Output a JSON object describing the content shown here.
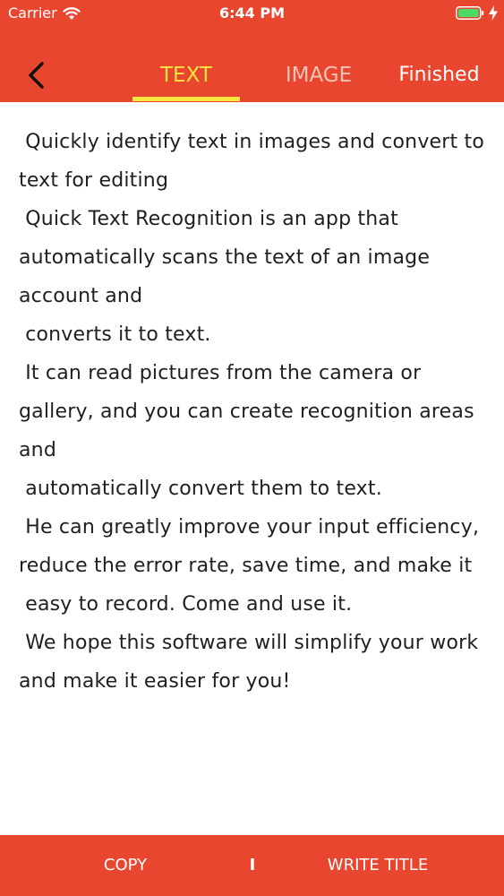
{
  "status_bar": {
    "carrier": "Carrier",
    "time": "6:44 PM",
    "icons": [
      "wifi-icon",
      "battery-icon",
      "charging-bolt-icon"
    ]
  },
  "nav": {
    "back_icon": "chevron-left-icon",
    "tabs": [
      {
        "label": "TEXT",
        "selected": true
      },
      {
        "label": "IMAGE",
        "selected": false
      }
    ],
    "finished_label": "Finished"
  },
  "content": {
    "text": " Quickly identify text in images and convert to text for editing\n Quick Text Recognition is an app that automatically scans the text of an image account and\n converts it to text.\n It can read pictures from the camera or gallery, and you can create recognition areas and\n automatically convert them to text.\n He can greatly improve your input efficiency, reduce the error rate, save time, and make it\n easy to record. Come and use it.\n We hope this software will simplify your work and make it easier for you!"
  },
  "bottom_bar": {
    "copy_label": "COPY",
    "divider": "I",
    "write_title_label": "WRITE TITLE"
  },
  "colors": {
    "accent": "#E9462F",
    "selected_tab": "#F7E53E",
    "unselected_tab": "#F6C3B6",
    "text": "#1F1F1F",
    "battery": "#4CD964"
  }
}
